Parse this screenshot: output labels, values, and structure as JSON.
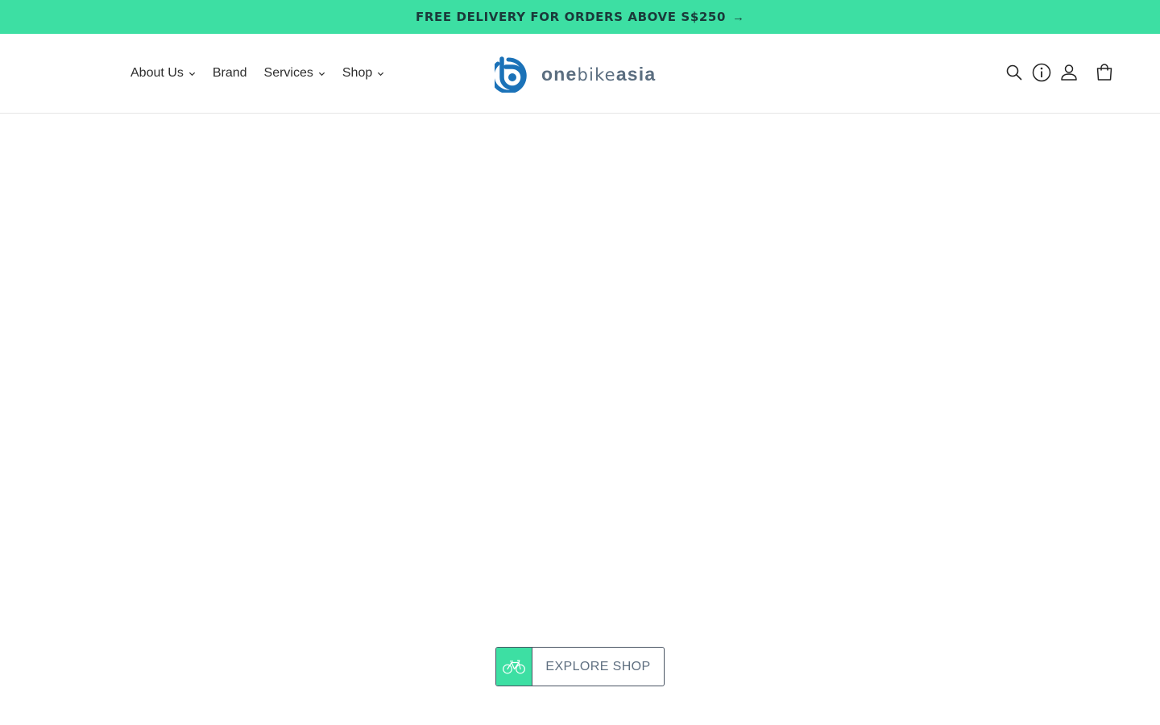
{
  "announcement": {
    "text": "FREE DELIVERY FOR ORDERS ABOVE S$250",
    "arrow": "→",
    "background_color": "#3ddfa3",
    "text_color": "#1a3a3a"
  },
  "nav": {
    "items": [
      {
        "label": "About Us",
        "has_dropdown": true
      },
      {
        "label": "Brand",
        "has_dropdown": false
      },
      {
        "label": "Services",
        "has_dropdown": true
      },
      {
        "label": "Shop",
        "has_dropdown": true
      }
    ]
  },
  "logo": {
    "word1": "one",
    "word2": "bike",
    "word3": "asia",
    "mark_color": "#1b72b8",
    "text_color": "#5b6e80"
  },
  "header_icons": [
    "search-icon",
    "info-icon",
    "account-icon",
    "cart-icon"
  ],
  "cta": {
    "label": "EXPLORE SHOP",
    "icon": "bicycle-icon",
    "icon_box_color": "#3ddfa3"
  }
}
